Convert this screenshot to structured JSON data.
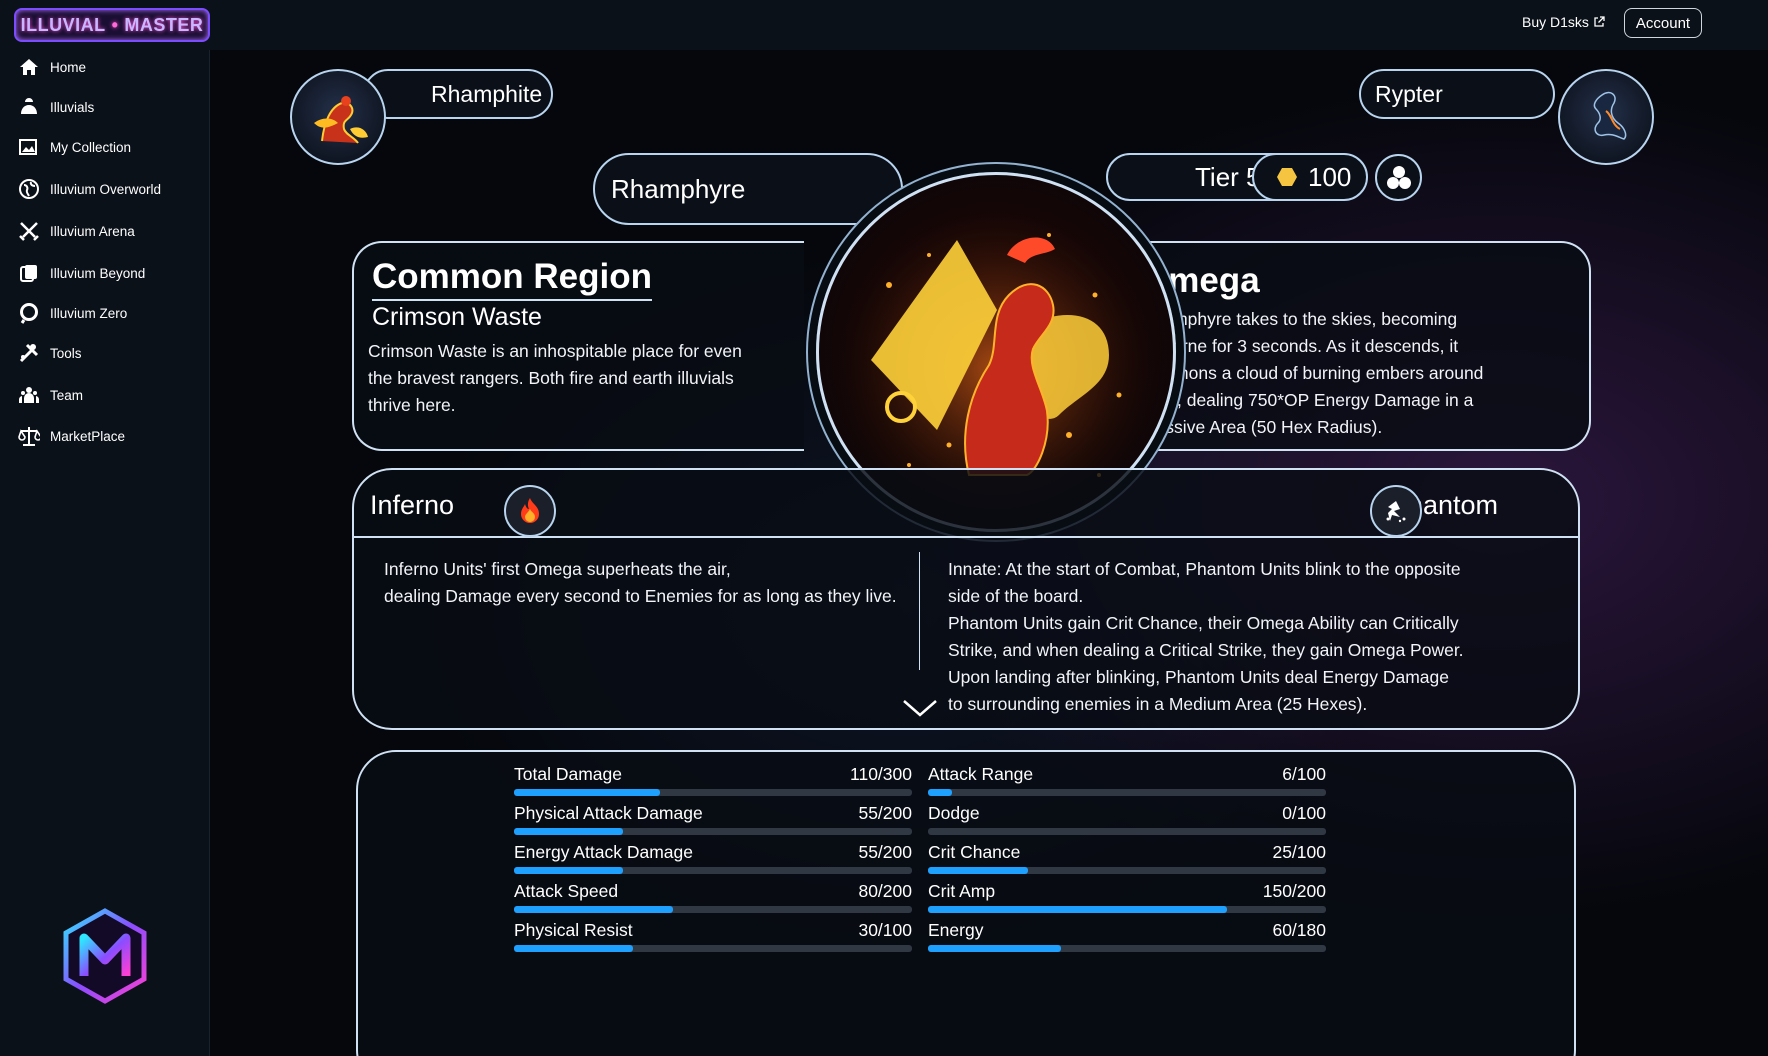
{
  "header": {
    "logo_left": "ILLUVIAL",
    "logo_right": "MASTER",
    "buy_label": "Buy D1sks",
    "account_label": "Account"
  },
  "sidebar": {
    "items": [
      {
        "label": "Home",
        "icon": "home-icon"
      },
      {
        "label": "Illuvials",
        "icon": "creature-icon"
      },
      {
        "label": "My Collection",
        "icon": "gallery-icon"
      },
      {
        "label": "Illuvium Overworld",
        "icon": "globe-icon"
      },
      {
        "label": "Illuvium Arena",
        "icon": "crossed-swords-icon"
      },
      {
        "label": "Illuvium Beyond",
        "icon": "cards-icon"
      },
      {
        "label": "Illuvium Zero",
        "icon": "zero-icon"
      },
      {
        "label": "Tools",
        "icon": "tools-icon"
      },
      {
        "label": "Team",
        "icon": "team-icon"
      },
      {
        "label": "MarketPlace",
        "icon": "scales-icon"
      }
    ]
  },
  "evolution": {
    "previous": "Rhamphite",
    "next": "Rypter",
    "current": "Rhamphyre"
  },
  "badges": {
    "tier": "Tier 5",
    "cost": "100"
  },
  "region": {
    "title": "Common Region",
    "name": "Crimson Waste",
    "description": "Crimson Waste is an inhospitable place for even the bravest rangers. Both fire and earth illuvials thrive here."
  },
  "omega": {
    "title": "Omega",
    "description": "Rhamphyre takes to the skies, becoming Airborne for 3 seconds. As it descends, it summons a cloud of burning embers around itself, dealing 750*OP Energy Damage in a Massive Area (50 Hex Radius)."
  },
  "synergies": {
    "affinity": {
      "name": "Inferno",
      "icon": "fire-icon",
      "line1": "Inferno Units' first Omega superheats the air,",
      "line2": "dealing Damage every second to Enemies for as long as they live."
    },
    "class": {
      "name": "Phantom",
      "icon": "phantom-icon",
      "line1": "Innate: At the start of Combat, Phantom Units blink to the opposite side of the board.",
      "line2": "Phantom Units gain Crit Chance, their Omega Ability can Critically Strike, and when dealing a Critical Strike, they gain Omega Power. Upon landing after blinking, Phantom Units deal Energy Damage to surrounding enemies in a Medium Area (25 Hexes)."
    }
  },
  "stats": {
    "left": [
      {
        "label": "Total Damage",
        "value": "110/300",
        "fraction": 0.3667
      },
      {
        "label": "Physical Attack Damage",
        "value": "55/200",
        "fraction": 0.275
      },
      {
        "label": "Energy Attack Damage",
        "value": "55/200",
        "fraction": 0.275
      },
      {
        "label": "Attack Speed",
        "value": "80/200",
        "fraction": 0.4
      },
      {
        "label": "Physical Resist",
        "value": "30/100",
        "fraction": 0.3
      }
    ],
    "right": [
      {
        "label": "Attack Range",
        "value": "6/100",
        "fraction": 0.06
      },
      {
        "label": "Dodge",
        "value": "0/100",
        "fraction": 0
      },
      {
        "label": "Crit Chance",
        "value": "25/100",
        "fraction": 0.25
      },
      {
        "label": "Crit Amp",
        "value": "150/200",
        "fraction": 0.75
      },
      {
        "label": "Energy",
        "value": "60/180",
        "fraction": 0.3333
      }
    ]
  },
  "colors": {
    "accent": "#1ea0ff",
    "panel_border": "#cfe1f2",
    "background": "#05070c"
  }
}
